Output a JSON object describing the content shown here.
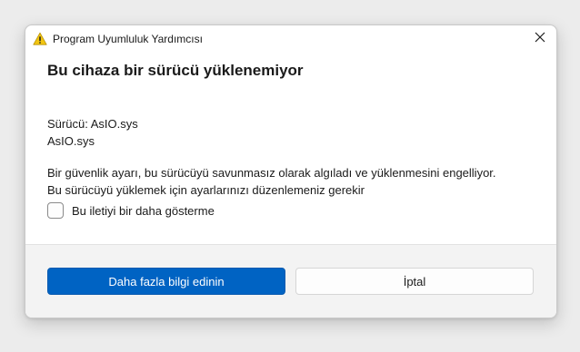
{
  "window": {
    "title": "Program Uyumluluk Yardımcısı",
    "title_icon": "warning-icon",
    "close_icon": "close-icon"
  },
  "main": {
    "heading": "Bu cihaza bir sürücü yüklenemiyor",
    "driver_line": "Sürücü: AsIO.sys",
    "driver_file": "AsIO.sys",
    "message_line1": "Bir güvenlik ayarı, bu sürücüyü savunmasız olarak algıladı ve yüklenmesini engelliyor.",
    "message_line2": "Bu sürücüyü yüklemek için ayarlarınızı düzenlemeniz gerekir",
    "checkbox_label": "Bu iletiyi bir daha gösterme",
    "checkbox_checked": false
  },
  "footer": {
    "primary_label": "Daha fazla bilgi edinin",
    "secondary_label": "İptal"
  },
  "colors": {
    "accent": "#0063c3",
    "warning": "#f2c511"
  }
}
